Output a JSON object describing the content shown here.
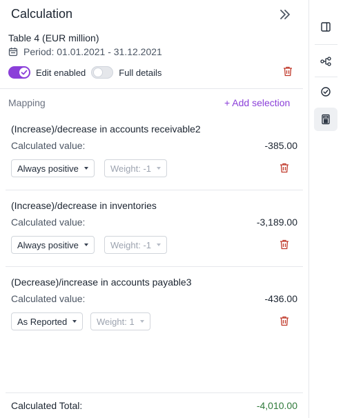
{
  "panel": {
    "title": "Calculation",
    "table_name": "Table 4 (EUR million)",
    "period": "Period: 01.01.2021 - 31.12.2021",
    "edit_enabled_label": "Edit enabled",
    "edit_enabled": true,
    "full_details_label": "Full details",
    "full_details": false
  },
  "mapping": {
    "label": "Mapping",
    "add_selection_label": "+ Add selection",
    "calc_label": "Calculated value:",
    "rows": [
      {
        "title": "(Increase)/decrease in accounts receivable2",
        "value": "-385.00",
        "sign_mode": "Always positive",
        "weight": "Weight: -1"
      },
      {
        "title": "(Increase)/decrease in inventories",
        "value": "-3,189.00",
        "sign_mode": "Always positive",
        "weight": "Weight: -1"
      },
      {
        "title": "(Decrease)/increase in accounts payable3",
        "value": "-436.00",
        "sign_mode": "As Reported",
        "weight": "Weight: 1"
      }
    ]
  },
  "total": {
    "label": "Calculated Total:",
    "value": "-4,010.00"
  },
  "rail": {
    "items": [
      {
        "icon": "split-view-icon"
      },
      {
        "icon": "hierarchy-icon"
      },
      {
        "icon": "check-circle-icon"
      },
      {
        "icon": "calculator-icon",
        "active": true
      }
    ]
  },
  "colors": {
    "accent": "#8b3fd9",
    "trash": "#c0392b",
    "positive_total": "#2f7a3a"
  }
}
